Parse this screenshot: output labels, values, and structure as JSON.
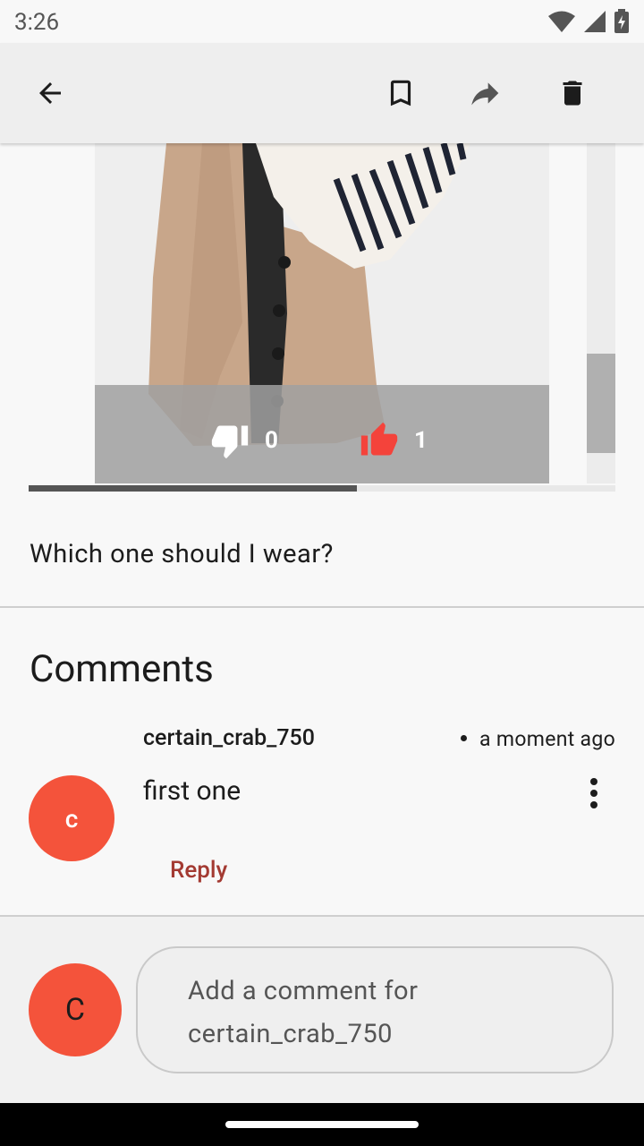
{
  "status_bar": {
    "time": "3:26"
  },
  "app_bar": {
    "back_icon": "arrow-left-icon",
    "bookmark_icon": "bookmark-outline-icon",
    "share_icon": "share-arrow-icon",
    "delete_icon": "trash-icon"
  },
  "post": {
    "votes": {
      "dislike_count": "0",
      "like_count": "1"
    },
    "carousel_progress": 0.56,
    "question": "Which one should I wear?"
  },
  "comments": {
    "title": "Comments",
    "items": [
      {
        "avatar_letter": "c",
        "username": "certain_crab_750",
        "time": "a moment ago",
        "body": "first one",
        "reply_label": "Reply"
      }
    ]
  },
  "composer": {
    "avatar_letter": "C",
    "placeholder_line1": "Add a comment for",
    "placeholder_line2": "certain_crab_750"
  },
  "colors": {
    "accent": "#f4533b",
    "reply": "#a33a32",
    "like": "#f4433b"
  }
}
